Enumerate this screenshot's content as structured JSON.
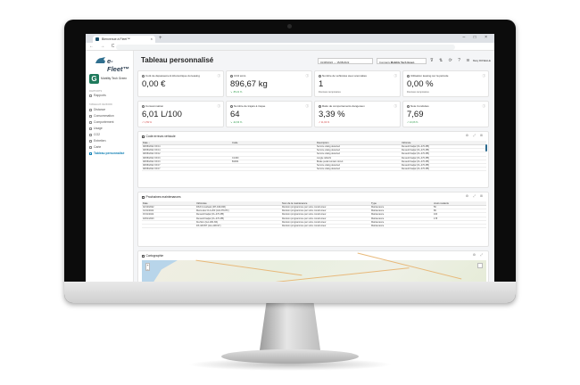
{
  "browser": {
    "tab_title": "Bienvenue à Fleet™",
    "tab_close": "×",
    "tab_add": "+",
    "window_controls": "– □ ×",
    "nav_buttons": "← → C ⌂"
  },
  "brand": {
    "name": "e-Fleet™"
  },
  "org": {
    "initial": "G",
    "name": "Mobility Tech Green"
  },
  "sidebar": {
    "section_reports_title": "RAPPORTS",
    "reports_item": "Rapports",
    "section_dash_title": "TABLEAUX DE BORD",
    "items": [
      {
        "label": "Distance",
        "icon": "route-icon"
      },
      {
        "label": "Consommation",
        "icon": "fuel-icon"
      },
      {
        "label": "Comportement",
        "icon": "steering-icon"
      },
      {
        "label": "Usage",
        "icon": "usage-icon"
      },
      {
        "label": "CO2",
        "icon": "leaf-icon"
      },
      {
        "label": "Entretien",
        "icon": "wrench-icon"
      },
      {
        "label": "Carte",
        "icon": "map-icon"
      },
      {
        "label": "Tableau personnalisé",
        "icon": "grid-icon"
      }
    ]
  },
  "header": {
    "title": "Tableau personnalisé",
    "date_range": "01/08/2022 → 15/08/2022",
    "company_label": "Company",
    "company_value": "Mobility Tech Green",
    "tools": "⊽ ⇅ ⟳ ? ≋",
    "user": "Mary ROSELLE"
  },
  "kpis": [
    {
      "label": "Coût de dépassement kilométrique du leasing",
      "value": "0,00 €",
      "sub": "",
      "trend": ""
    },
    {
      "label": "CO2 émis",
      "value": "896,67 kg",
      "sub": "↘ -55,21 %",
      "trend": "pos"
    },
    {
      "label": "Nombre de véhicules avec anomalies",
      "value": "1",
      "sub": "Données temporaires",
      "trend": ""
    },
    {
      "label": "Utilisation leasing sur la période",
      "value": "0,00 %",
      "sub": "Données temporaires",
      "trend": ""
    },
    {
      "label": "Consommation",
      "value": "6,01 L/100",
      "sub": "↗ 1,59 %",
      "trend": "neg"
    },
    {
      "label": "Nombre de trajets à risque",
      "value": "64",
      "sub": "↘ -32,63 %",
      "trend": "pos"
    },
    {
      "label": "Ratio de comportements dangereux",
      "value": "3,39 %",
      "sub": "↗ 11,63 %",
      "trend": "neg"
    },
    {
      "label": "Note Conduites",
      "value": "7,69",
      "sub": "↗ 10,06 %",
      "trend": "pos"
    }
  ],
  "alerts_panel": {
    "title": "Code erreurs véhicule",
    "tools": "⚙ ⤢ ⊞",
    "columns": [
      "Date ↓",
      "Code",
      "Description",
      "Véhicule"
    ],
    "rows": [
      [
        "08/08/2022 15:04",
        "",
        "Service vialog detected",
        "Renault Kadjar (FL-470-PB)"
      ],
      [
        "08/08/2022 15:04",
        "",
        "Service vialog detected",
        "Renault Kadjar (FL-470-PB)"
      ],
      [
        "08/08/2022 15:02",
        "",
        "Service vialog detected",
        "Renault Kadjar (FL-470-PB)"
      ],
      [
        "08/08/2022 15:03",
        "C1460",
        "Jungle réfléchi",
        "Renault Kadjar (FL-470-PB)"
      ],
      [
        "08/08/2022 15:03",
        "B1964",
        "Brake pedal contact circuit",
        "Renault Kadjar (FL-470-PB)"
      ],
      [
        "08/08/2022 15:07",
        "",
        "Service vialog detected",
        "Renault Kadjar (FL-470-PB)"
      ],
      [
        "08/08/2022 15:07",
        "",
        "Service vialog detected",
        "Renault Kadjar (FL-470-PB)"
      ]
    ]
  },
  "maintenance_panel": {
    "title": "Prochaines maintenances",
    "tools": "⚙ ⤢ ⊞",
    "columns": [
      "Date",
      "Véhicules",
      "Nom de la maintenance",
      "Type",
      "Jours restants"
    ],
    "rows": [
      [
        "02/10/2022",
        "DS3 Crossback (FH-949-RM)",
        "Révision programmée par votre constructeur",
        "Maintenance",
        "56"
      ],
      [
        "01/11/2022",
        "Mercedes CLA 200 (GD-379-HF)",
        "Révision programmée par votre constructeur",
        "Maintenance",
        "86"
      ],
      [
        "15/11/2022",
        "Renault Kadjar (FL-470-PB)",
        "Révision programmée par votre constructeur",
        "Maintenance",
        "100"
      ],
      [
        "18/01/2023",
        "Renault Kadjar (FL-470-PB)",
        "Révision programmée par votre constructeur",
        "Maintenance",
        "178"
      ],
      [
        "",
        "Kia Niro (GA-180-NS)",
        "Révision programmée par votre constructeur",
        "Maintenance",
        ""
      ],
      [
        "",
        "DS 408 BT (GG-408-ST)",
        "Révision programmée par votre constructeur",
        "Maintenance",
        ""
      ]
    ]
  },
  "map_panel": {
    "title": "Cartographie",
    "tools": "⚙ ⤢",
    "zoom_in": "+",
    "zoom_out": "−"
  }
}
